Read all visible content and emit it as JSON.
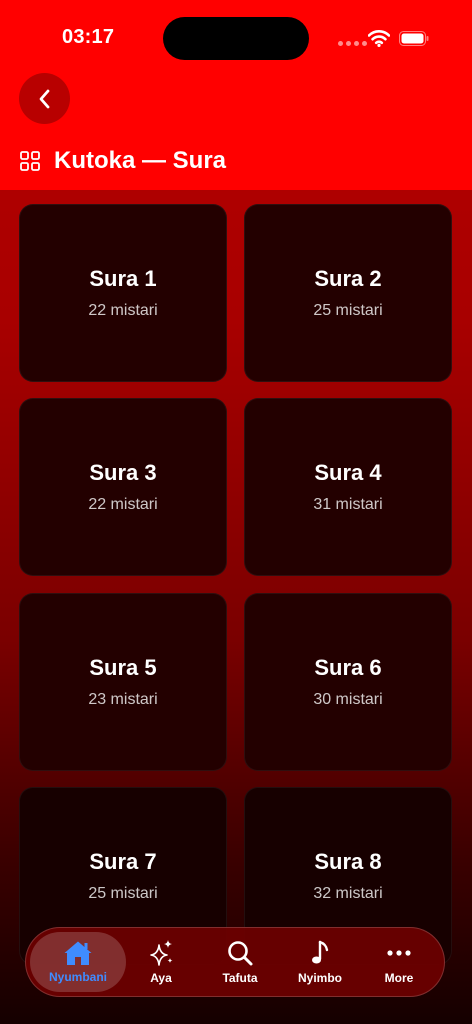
{
  "status": {
    "time": "03:17"
  },
  "header": {
    "title": "Kutoka — Sura"
  },
  "cards": [
    {
      "title": "Sura 1",
      "subtitle": "22 mistari"
    },
    {
      "title": "Sura 2",
      "subtitle": "25 mistari"
    },
    {
      "title": "Sura 3",
      "subtitle": "22 mistari"
    },
    {
      "title": "Sura 4",
      "subtitle": "31 mistari"
    },
    {
      "title": "Sura 5",
      "subtitle": "23 mistari"
    },
    {
      "title": "Sura 6",
      "subtitle": "30 mistari"
    },
    {
      "title": "Sura 7",
      "subtitle": "25 mistari"
    },
    {
      "title": "Sura 8",
      "subtitle": "32 mistari"
    }
  ],
  "tabs": [
    {
      "label": "Nyumbani",
      "icon": "house-icon",
      "active": true
    },
    {
      "label": "Aya",
      "icon": "sparkles-icon"
    },
    {
      "label": "Tafuta",
      "icon": "search-icon"
    },
    {
      "label": "Nyimbo",
      "icon": "music-note-icon"
    },
    {
      "label": "More",
      "icon": "more-icon"
    }
  ],
  "colors": {
    "header": "#ff0000",
    "accent": "#3f8cff",
    "card": "#230000"
  }
}
